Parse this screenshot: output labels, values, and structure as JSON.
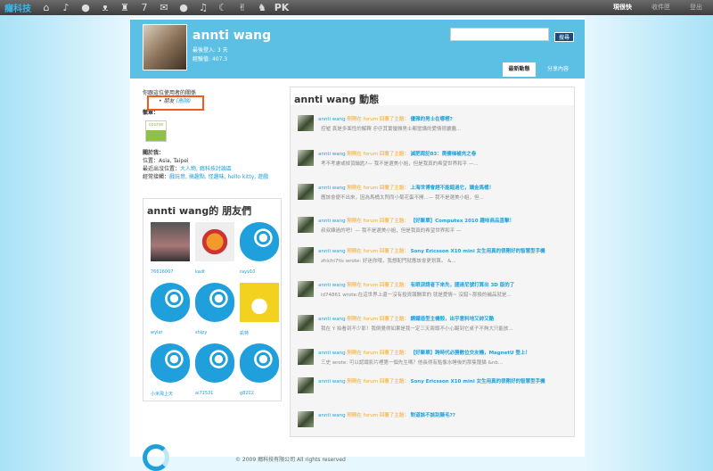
{
  "topbar": {
    "logo": "癮科技",
    "icons": [
      "home-icon",
      "music-icon",
      "chat-icon",
      "bow-icon",
      "android-icon",
      "seven-icon",
      "game-icon",
      "pet-icon",
      "guitar-icon",
      "phone-icon",
      "hand-icon",
      "rabbit-icon"
    ],
    "pk": "PK",
    "links": [
      "現很快",
      "收件匣",
      "登出"
    ]
  },
  "profile": {
    "name": "annti wang",
    "last_login": "最後登入: 3 天",
    "exp": "經驗值: 407.3",
    "search_button": "搜尋",
    "tabs": [
      "最新動態",
      "分享內容"
    ]
  },
  "left": {
    "relation_label": "你跟這位使用者的關係",
    "relation": "朋友",
    "remove": "(刪除)",
    "badges_label": "徽章：",
    "badge_text": "course",
    "about_label": "關於我：",
    "location": "位置：Asia, Taipei",
    "recent_label": "最近出沒位置：",
    "recent": "大人物, 癮科技討論區",
    "tags_label": "經常接觸：",
    "tags": "戲玩意, 搞趣點, 怪趣味, hello kitty, 遊戲"
  },
  "friends": {
    "title": "annti wang的 朋友們",
    "items": [
      "76616007",
      "kadt",
      "rayv10",
      "wylar",
      "shipy",
      "凱特",
      "小米飛上天",
      "ai71531",
      "g8202"
    ]
  },
  "feed": {
    "title": "annti wang 動態",
    "user": "annti wang",
    "action1": "剛剛在",
    "forum": "forum",
    "action2": "回覆了主題：",
    "items": [
      {
        "topic": "優雅的男士在哪裡?",
        "excerpt": "控噓   真是多面性的解釋 ＠＠其實優雅男士都蠻講的愛情很嚴蠢..."
      },
      {
        "topic": "減肥周記03：爬樓梯補充之卷",
        "excerpt": "考不考慮或掉頂鑰匙?— 我不是選美小姐，但是我真的希望世界和平 —..."
      },
      {
        "topic": "上海世博會趕不能錯過它，讓金馬桶！",
        "excerpt": "應該會便不出來，因為馬桶太閃而小菊花蛋不開...— 我不是選美小姐，但..."
      },
      {
        "topic": "【好聚單】Computex 2010 趣味商品直擊！",
        "excerpt": "叔叔練過的吧！— 我不是選美小姐，但是我真的希望世界和平 —"
      },
      {
        "topic": "Sony Ericsson X10 mini 女生用真的很剛好的智慧型手機",
        "excerpt": "zhichi7tis wrote:   好迷你哦，我想配門就應該會更划算。 &..."
      },
      {
        "topic": "有眼淚請者下來先，國達尼號打算出 3D 版的了",
        "excerpt": "id74861 wrote:在這世界上還一沒有投資報酬率的 就是愛情~ 沒錯~那換的補品就是..."
      },
      {
        "topic": "鋼鐵造型主機殼，出乎意料地又帥又酷",
        "excerpt": "我在 Y 拍看到不少耶！我倒覺得如果是我一定三天兩頭不小心踢到它桌子不夠大只能放..."
      },
      {
        "topic": "【好聚單】跨時代必勝數位交友機，MagnetU 登上！",
        "excerpt": "三史 wrote: 可以認識影片裡第一個先生嗎？他長得有點像水睡後的那隻龍猫 &nb..."
      },
      {
        "topic": "Sony Ericsson X10 mini 女生用真的很剛好的智慧型手機",
        "excerpt": ""
      },
      {
        "topic": "對道該不該刮腋毛??",
        "excerpt": ""
      }
    ]
  },
  "footer": {
    "text": "© 2009 癮科技有限公司  All rights reserved"
  }
}
